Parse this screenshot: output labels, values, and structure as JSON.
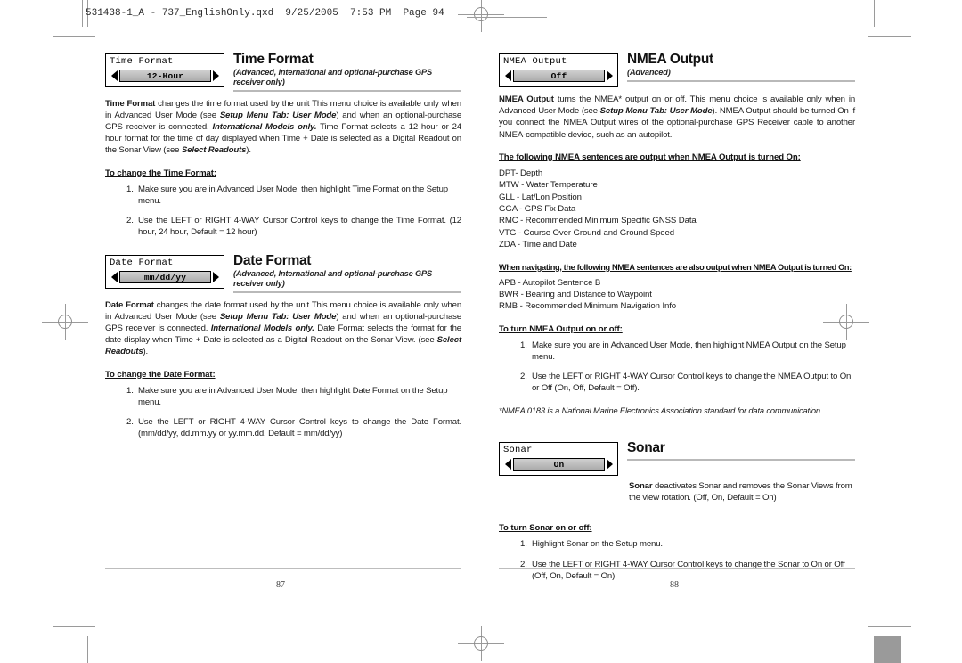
{
  "file_header": "531438-1_A - 737_EnglishOnly.qxd  9/25/2005  7:53 PM  Page 94",
  "left_page": {
    "number": "87",
    "sections": [
      {
        "widget_title": "Time Format",
        "widget_value": "12-Hour",
        "title": "Time Format",
        "subtitle": "(Advanced, International and optional-purchase GPS receiver only)",
        "subhead": "To change the Time Format:",
        "steps": [
          "Make sure you are in Advanced User Mode, then highlight Time Format on the Setup menu.",
          "Use the LEFT or RIGHT 4-WAY Cursor Control keys to change the Time Format. (12 hour, 24 hour, Default = 12 hour)"
        ]
      },
      {
        "widget_title": "Date Format",
        "widget_value": "mm/dd/yy",
        "title": "Date Format",
        "subtitle": "(Advanced, International and optional-purchase GPS receiver only)",
        "subhead": "To change the Date Format:",
        "steps": [
          "Make sure you are in Advanced User Mode, then highlight Date Format on the Setup menu.",
          "Use the LEFT or RIGHT 4-WAY Cursor Control keys to change the Date Format. (mm/dd/yy, dd.mm.yy or yy.mm.dd, Default = mm/dd/yy)"
        ]
      }
    ]
  },
  "right_page": {
    "number": "88",
    "nmea": {
      "widget_title": "NMEA Output",
      "widget_value": "Off",
      "title": "NMEA Output",
      "subtitle": "(Advanced)",
      "list_heading_1": "The following NMEA sentences are output when NMEA Output is turned On:",
      "sentences_1": [
        "DPT- Depth",
        "MTW - Water Temperature",
        "GLL - Lat/Lon Position",
        "GGA - GPS Fix Data",
        "RMC - Recommended Minimum Specific GNSS Data",
        "VTG - Course Over Ground and Ground Speed",
        "ZDA - Time and Date"
      ],
      "list_heading_2": "When navigating, the following NMEA sentences are also output when NMEA Output is turned On:",
      "sentences_2": [
        "APB - Autopilot Sentence B",
        "BWR - Bearing and Distance to Waypoint",
        "RMB - Recommended Minimum Navigation Info"
      ],
      "subhead": "To turn NMEA Output on or off:",
      "steps": [
        "Make sure you are in Advanced User Mode, then highlight NMEA Output on the Setup menu.",
        "Use the LEFT or RIGHT 4-WAY Cursor Control keys to change the NMEA Output to On or Off (On, Off, Default = Off)."
      ],
      "footnote": "*NMEA 0183 is a National Marine Electronics Association standard for data communication."
    },
    "sonar": {
      "widget_title": "Sonar",
      "widget_value": "On",
      "title": "Sonar",
      "subhead": "To turn Sonar on or off:",
      "steps": [
        "Highlight Sonar on the Setup menu.",
        "Use the LEFT or RIGHT 4-WAY Cursor Control keys to change the Sonar to On or Off (Off, On, Default = On)."
      ]
    }
  }
}
